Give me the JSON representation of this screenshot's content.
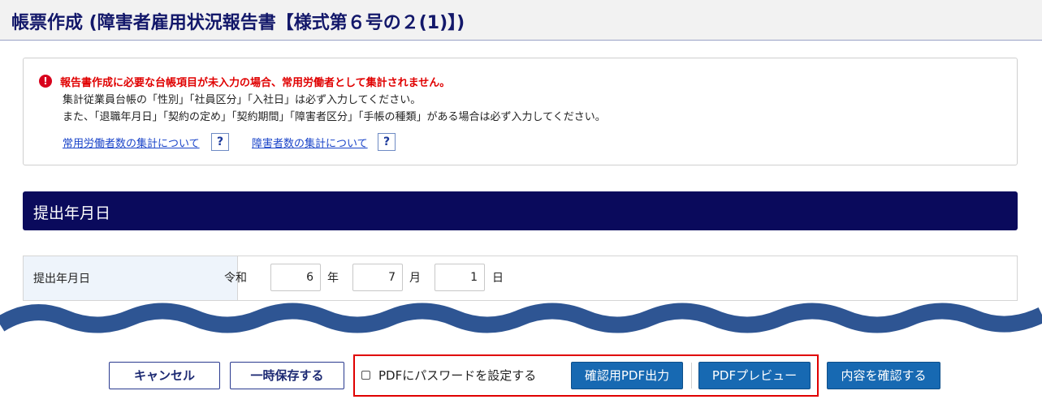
{
  "header": {
    "title": "帳票作成 (障害者雇用状況報告書【様式第６号の２(1)】)"
  },
  "notice": {
    "icon": "exclamation-circle-icon",
    "error_text": "報告書作成に必要な台帳項目が未入力の場合、常用労働者として集計されません。",
    "line1": "集計従業員台帳の「性別」「社員区分」「入社日」は必ず入力してください。",
    "line2": "また、「退職年月日」「契約の定め」「契約期間」「障害者区分」「手帳の種類」がある場合は必ず入力してください。",
    "links": [
      {
        "label": "常用労働者数の集計について",
        "help": "?"
      },
      {
        "label": "障害者数の集計について",
        "help": "?"
      }
    ]
  },
  "section": {
    "title": "提出年月日"
  },
  "form": {
    "label": "提出年月日",
    "era": "令和",
    "year": "6",
    "year_unit": "年",
    "month": "7",
    "month_unit": "月",
    "day": "1",
    "day_unit": "日"
  },
  "footer": {
    "cancel_label": "キャンセル",
    "save_label": "一時保存する",
    "password_label": "PDFにパスワードを設定する",
    "password_checked": false,
    "pdf_output_label": "確認用PDF出力",
    "pdf_preview_label": "PDFプレビュー",
    "confirm_label": "内容を確認する"
  },
  "colors": {
    "header_text": "#13186a",
    "section_bar": "#0a0a5c",
    "error_text": "#e00000",
    "link": "#1a44c9",
    "primary_button": "#1769b2",
    "highlight_border": "#e00000",
    "wave": "#2e5593"
  }
}
